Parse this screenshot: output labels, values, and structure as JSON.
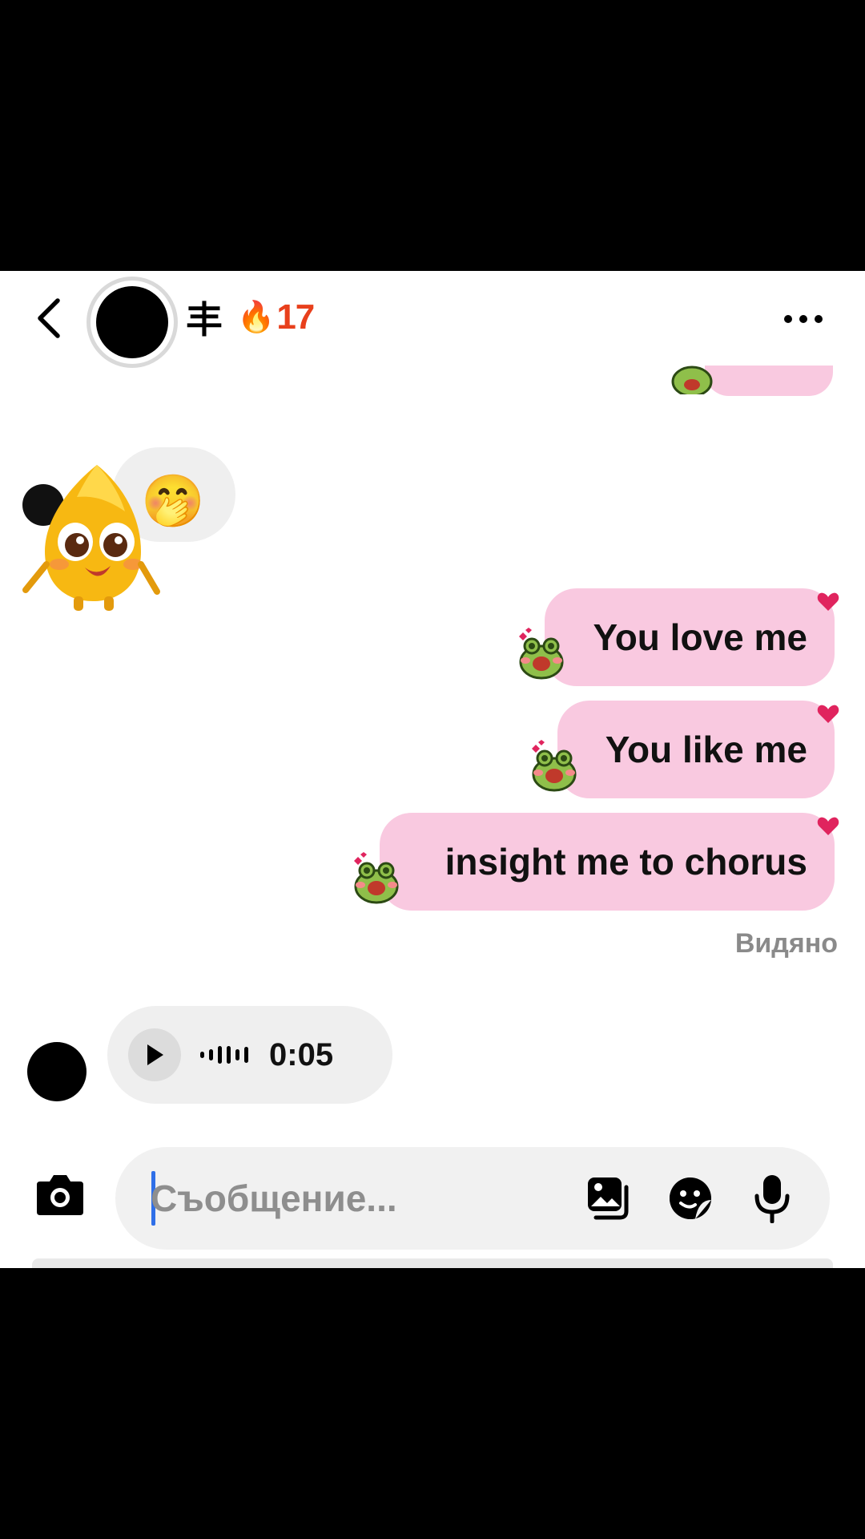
{
  "header": {
    "username": "丰",
    "streak_emoji": "🔥",
    "streak_count": "17",
    "back_icon": "chevron-left-icon",
    "more_icon": "more-horizontal-icon"
  },
  "messages": {
    "received_reaction": "🤭",
    "sent": [
      {
        "text": "You love me"
      },
      {
        "text": "You like me"
      },
      {
        "text": "insight me to chorus"
      }
    ],
    "seen_label": "Видяно",
    "voice": {
      "duration": "0:05"
    }
  },
  "composer": {
    "placeholder": "Съобщение...",
    "value": "",
    "icons": [
      "camera-icon",
      "gallery-icon",
      "sticker-icon",
      "microphone-icon"
    ]
  },
  "colors": {
    "sent_bubble": "#f9c9e0",
    "received_bubble": "#efefef",
    "streak": "#e8401c",
    "heart": "#e0245e",
    "caret": "#2f6fe8"
  }
}
